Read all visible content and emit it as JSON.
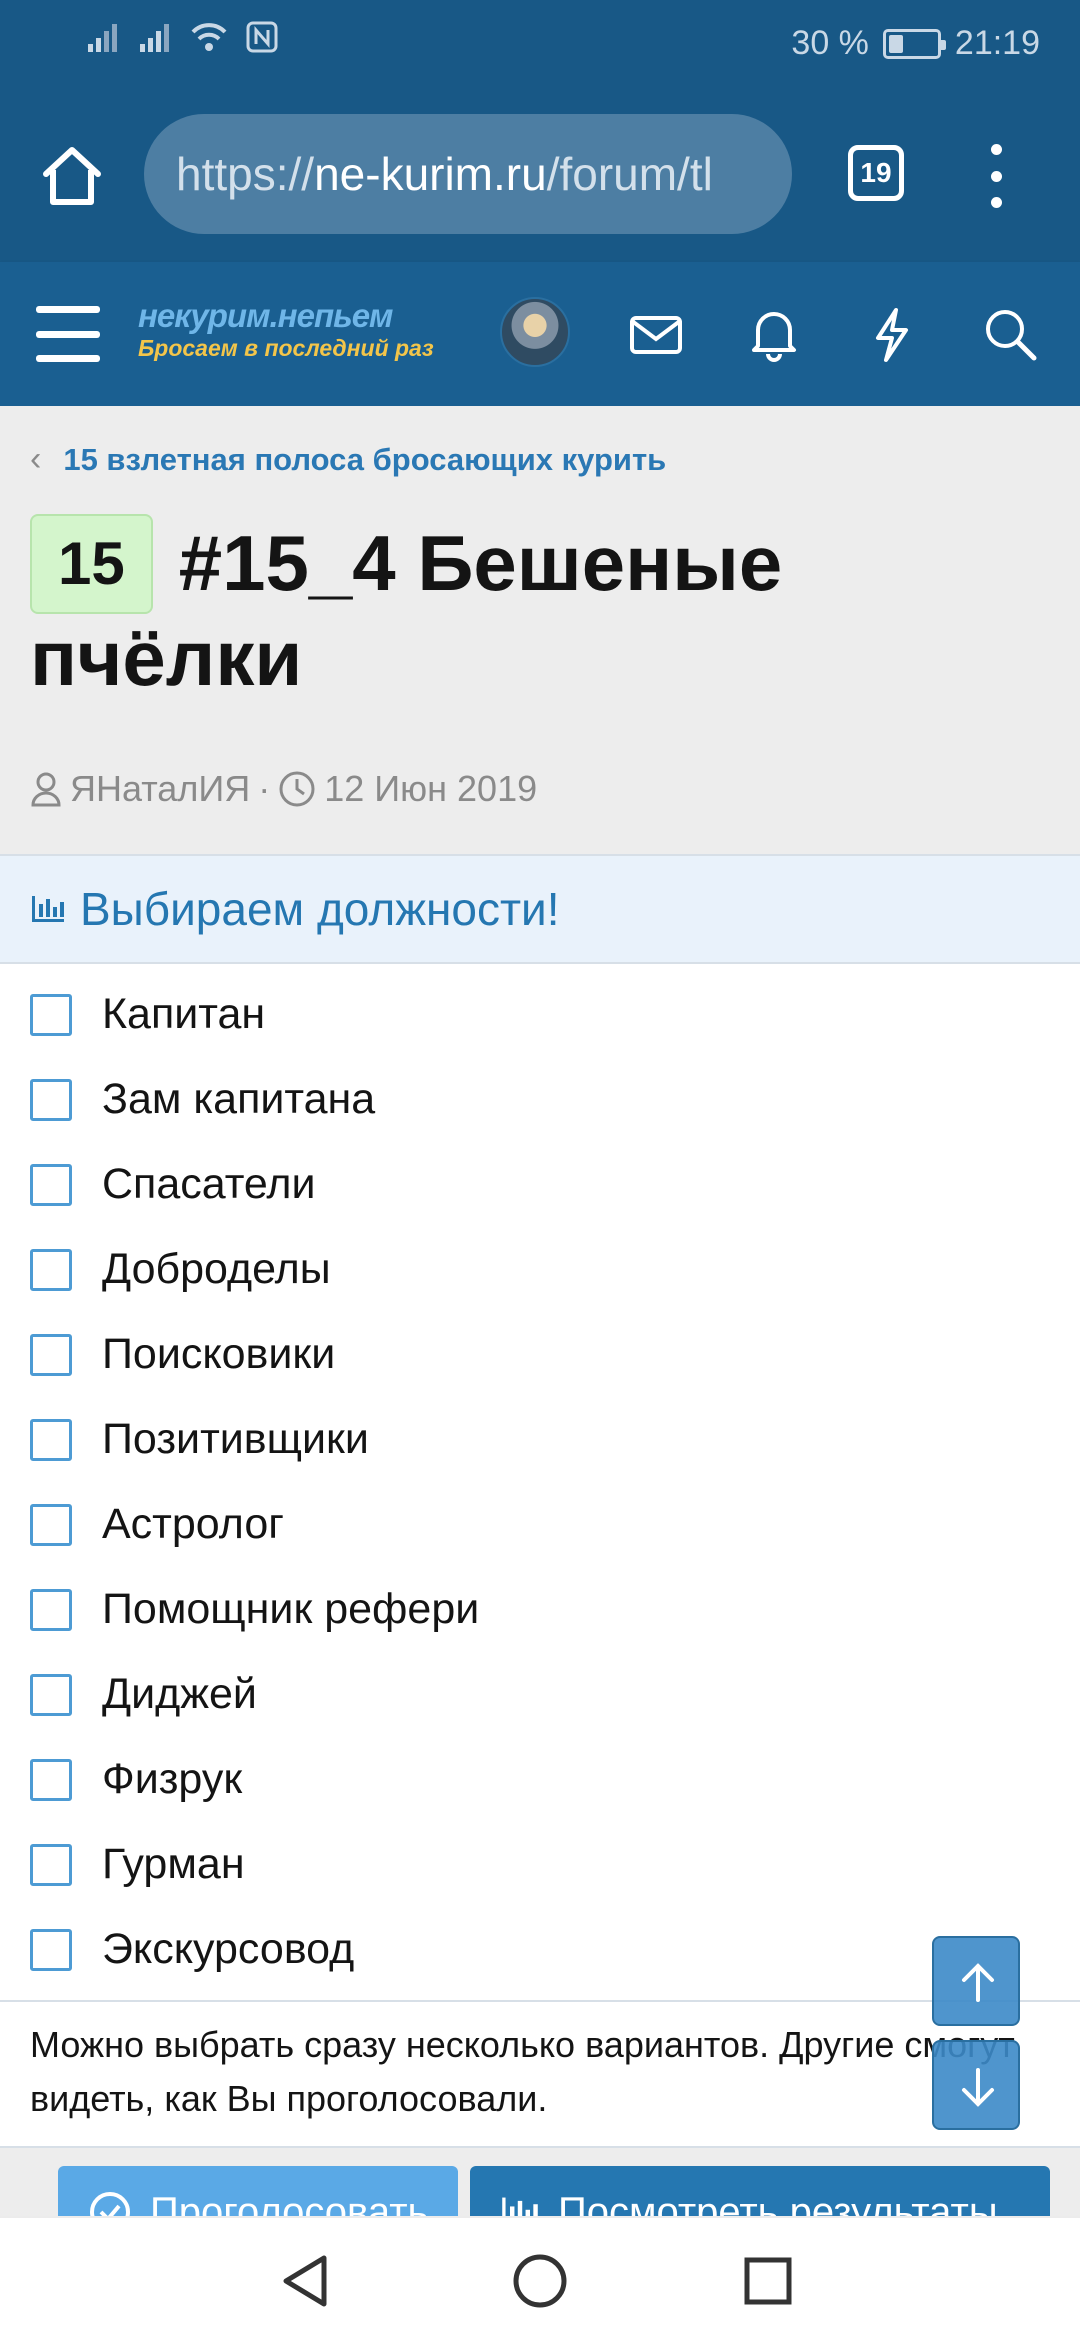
{
  "status_bar": {
    "battery": "30 %",
    "battery_level": 0.3,
    "time": "21:19"
  },
  "browser": {
    "url_scheme": "https://",
    "url_host": "ne-kurim.ru",
    "url_path": "/forum/tl",
    "tab_count": "19"
  },
  "site": {
    "logo_top": "некурим.непьем",
    "logo_bottom": "Бросаем в последний раз"
  },
  "thread": {
    "breadcrumb": "15 взлетная полоса бросающих курить",
    "prefix": "15",
    "title": "#15_4 Бешеные пчёлки",
    "author": "ЯНаталИЯ",
    "separator": "·",
    "date": "12 Июн 2019"
  },
  "poll": {
    "title": "Выбираем должности!",
    "options": [
      "Капитан",
      "Зам капитана",
      "Спасатели",
      "Доброделы",
      "Поисковики",
      "Позитивщики",
      "Астролог",
      "Помощник рефери",
      "Диджей",
      "Физрук",
      "Гурман",
      "Экскурсовод"
    ],
    "hint": "Можно выбрать сразу несколько вариантов. Другие смогут видеть, как Вы проголосовали.",
    "vote_label": "Проголосовать",
    "results_label": "Посмотреть результаты"
  },
  "colors": {
    "browser_bar": "#185886",
    "site_header": "#1a5f91",
    "accent": "#2577b1",
    "prefix_badge": "#d4f5cc"
  }
}
